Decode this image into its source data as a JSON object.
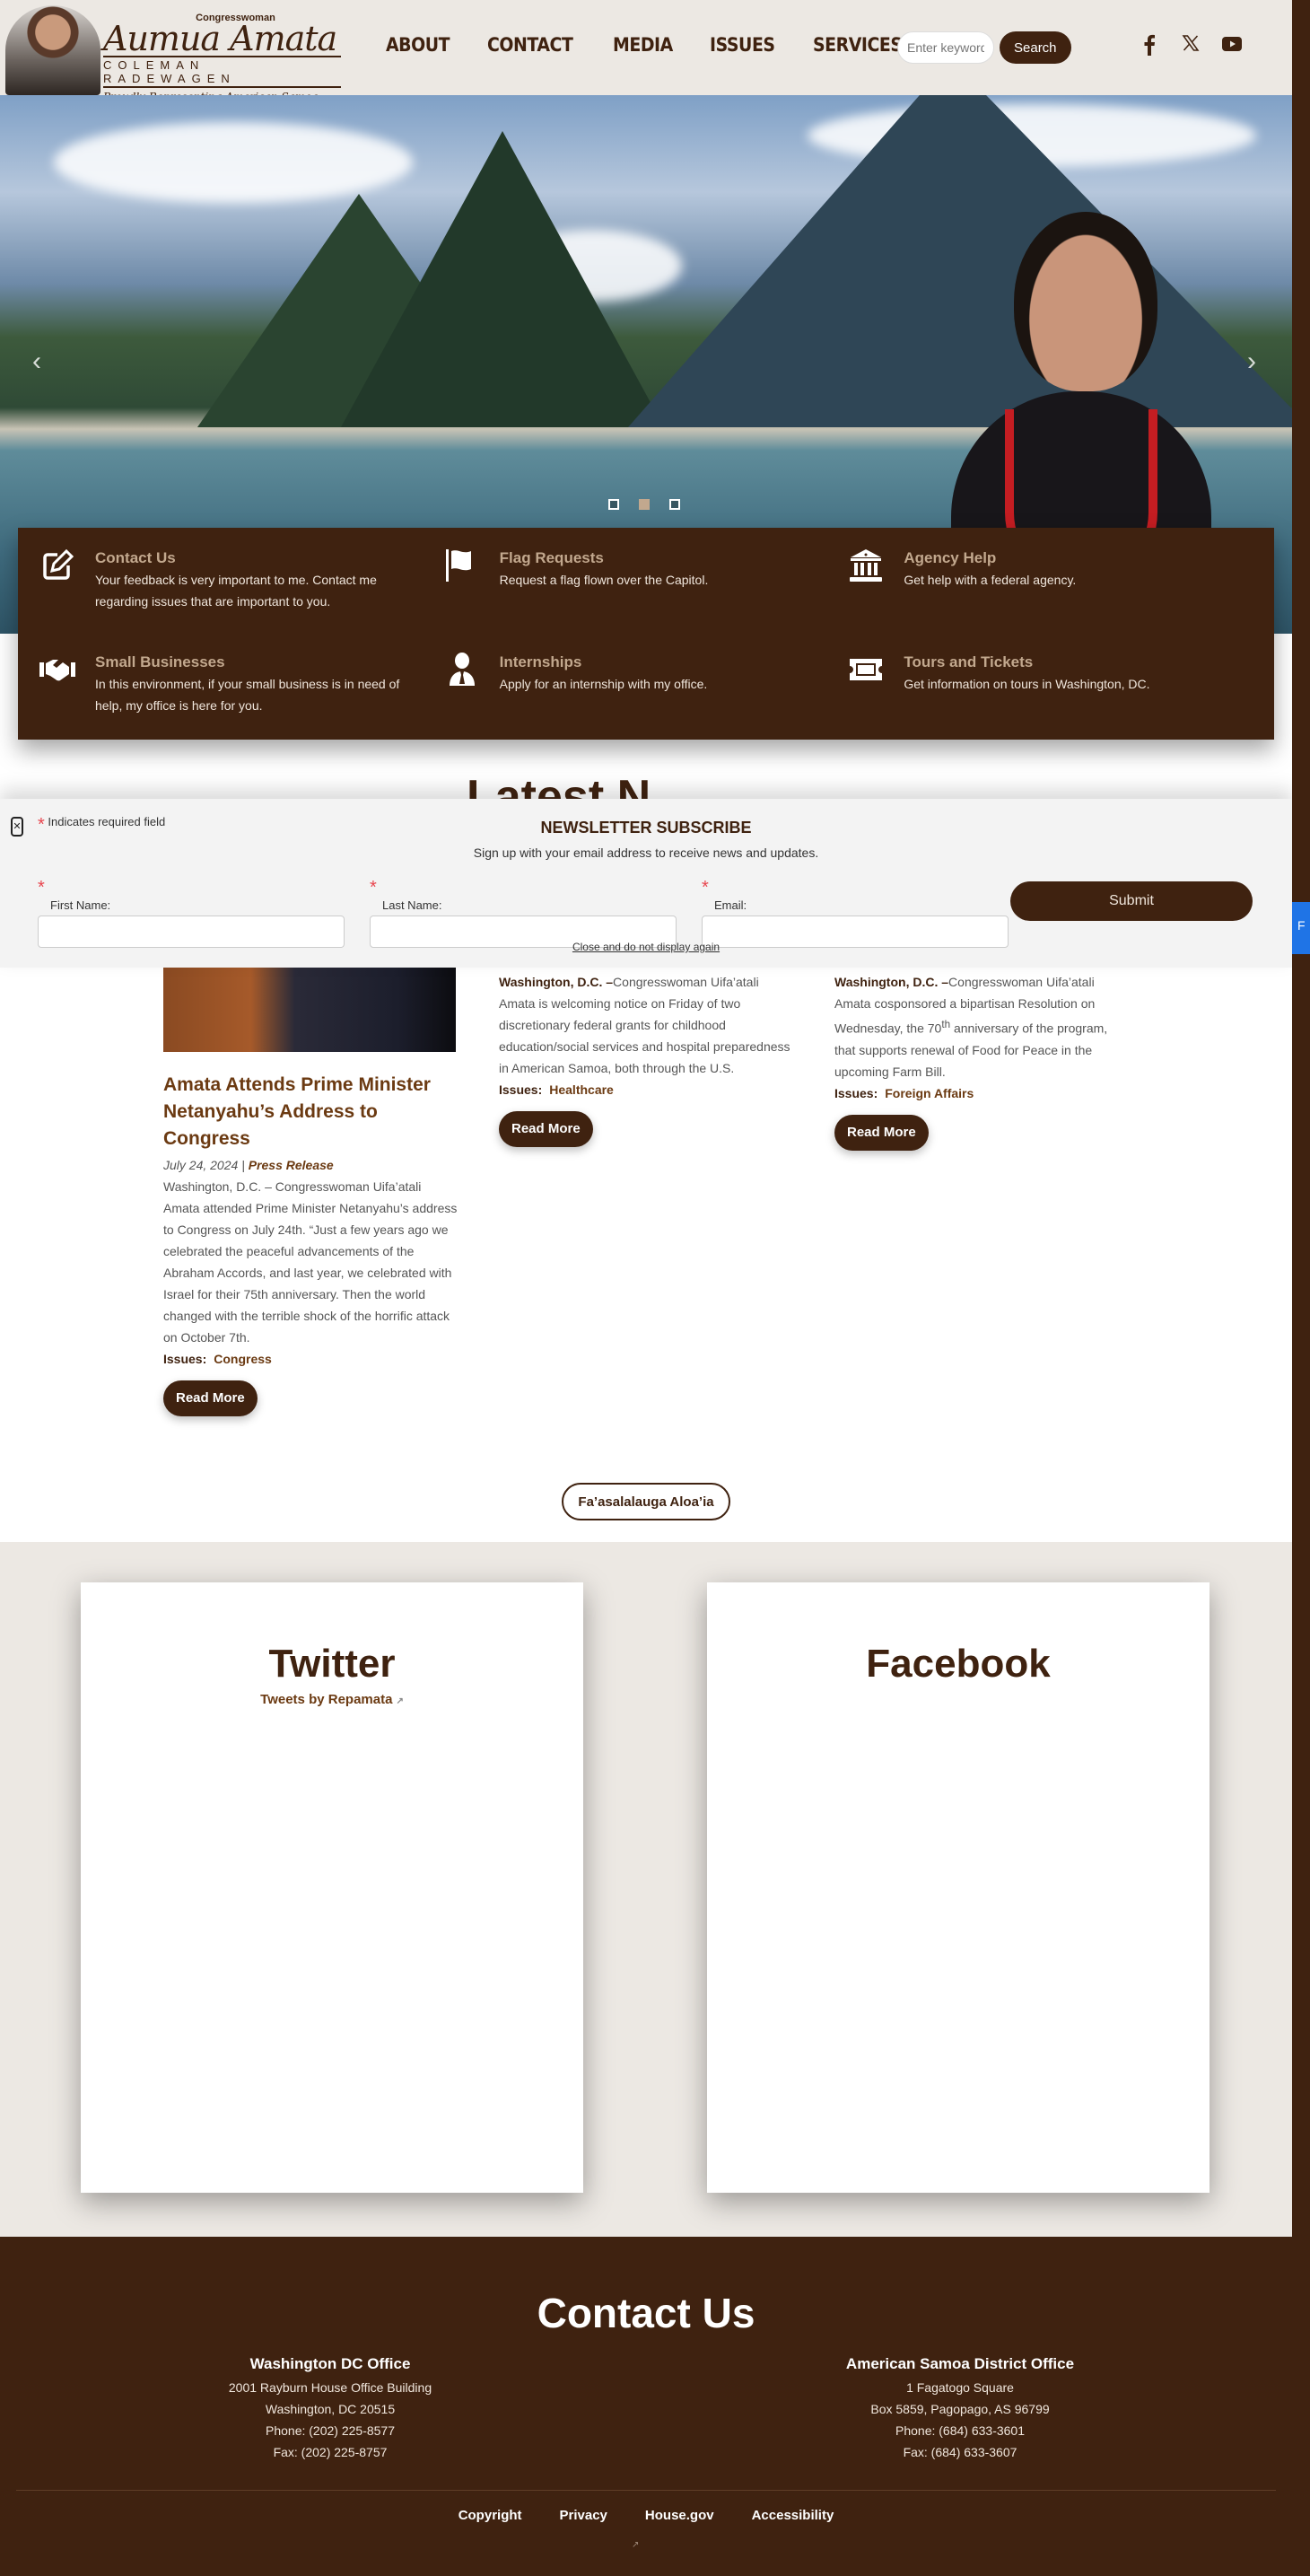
{
  "header": {
    "logo": {
      "title_small": "Congresswoman",
      "name_script": "Aumua Amata",
      "name_caps": "COLEMAN RADEWAGEN",
      "tagline": "Proudly Representing American Samoa"
    },
    "nav": [
      "ABOUT",
      "CONTACT",
      "MEDIA",
      "ISSUES",
      "SERVICES"
    ],
    "search": {
      "placeholder": "Enter keywords",
      "button_label": "Search"
    },
    "social_icons": [
      "facebook-icon",
      "x-icon",
      "youtube-icon"
    ]
  },
  "hero": {
    "prev_label": "‹",
    "next_label": "›",
    "slides": 3,
    "active_slide": 2
  },
  "services": [
    {
      "icon": "edit-icon",
      "title": "Contact Us",
      "description": "Your feedback is very important to me. Contact me regarding issues that are important to you."
    },
    {
      "icon": "flag-icon",
      "title": "Flag Requests",
      "description": "Request a flag flown over the Capitol."
    },
    {
      "icon": "building-icon",
      "title": "Agency Help",
      "description": "Get help with a federal agency."
    },
    {
      "icon": "handshake-icon",
      "title": "Small Businesses",
      "description": "In this environment, if your small business is in need of help, my office is here for you."
    },
    {
      "icon": "user-tie-icon",
      "title": "Internships",
      "description": "Apply for an internship with my office."
    },
    {
      "icon": "ticket-icon",
      "title": "Tours and Tickets",
      "description": "Get information on tours in Washington, DC."
    }
  ],
  "latest_news": {
    "heading_fragment": "Latest N",
    "articles": [
      {
        "title": "Amata Attends Prime Minister Netanyahu’s Address to Congress",
        "date": "July 24, 2024",
        "separator": "|",
        "type": "Press Release",
        "dateline": "",
        "body": "Washington, D.C. – Congresswoman Uifa’atali Amata attended Prime Minister Netanyahu’s address to Congress on July 24th. “Just a few years ago we celebrated the peaceful advancements of the Abraham Accords, and last year, we celebrated with Israel for their 75th anniversary. Then the world changed with the terrible shock of the horrific attack on October 7th.",
        "issues_label": "Issues:",
        "issue": "Congress",
        "read_more": "Read More"
      },
      {
        "dateline": "Washington, D.C. –",
        "body": "Congresswoman Uifa’atali Amata is welcoming notice on Friday of two discretionary federal grants for childhood education/social services and hospital preparedness in American Samoa, both through the U.S.",
        "issues_label": "Issues:",
        "issue": "Healthcare",
        "read_more": "Read More"
      },
      {
        "dateline": "Washington, D.C. –",
        "body_pre": "Congresswoman Uifa’atali Amata cosponsored a bipartisan Resolution on Wednesday, the 70",
        "body_sup": "th",
        "body_post": " anniversary of the program, that supports renewal of Food for Peace in the upcoming Farm Bill.",
        "issues_label": "Issues:",
        "issue": "Foreign Affairs",
        "read_more": "Read More"
      }
    ],
    "more_button": "Fa’asalalauga Aloa’ia"
  },
  "newsletter": {
    "close_icon": "close-icon",
    "required_note": "Indicates required field",
    "required_marker": "*",
    "title": "NEWSLETTER SUBSCRIBE",
    "subtitle": "Sign up with your email address to receive news and updates.",
    "fields": [
      {
        "label": "First Name:",
        "value": ""
      },
      {
        "label": "Last Name:",
        "value": ""
      },
      {
        "label": "Email:",
        "value": ""
      }
    ],
    "submit_label": "Submit",
    "dismiss_label": "Close and do not display again"
  },
  "feeds": {
    "twitter": {
      "title": "Twitter",
      "link": "Tweets by Repamata"
    },
    "facebook": {
      "title": "Facebook"
    }
  },
  "footer": {
    "heading": "Contact Us",
    "offices": [
      {
        "name": "Washington DC Office",
        "lines": [
          "2001 Rayburn House Office Building",
          "Washington, DC 20515",
          "Phone: (202) 225-8577",
          "Fax: (202) 225-8757"
        ]
      },
      {
        "name": "American Samoa District Office",
        "lines": [
          "1 Fagatogo Square",
          "Box 5859, Pagopago, AS 96799",
          "Phone: (684) 633-3601",
          "Fax: (684) 633-3607"
        ]
      }
    ],
    "links": [
      "Copyright",
      "Privacy",
      "House.gov",
      "Accessibility"
    ]
  },
  "colors": {
    "brand_brown": "#3f2210",
    "accent_tan": "#c2a88e",
    "link_brown": "#6b3a12",
    "required_red": "#e8454e",
    "feedback_blue": "#1f74e6"
  }
}
